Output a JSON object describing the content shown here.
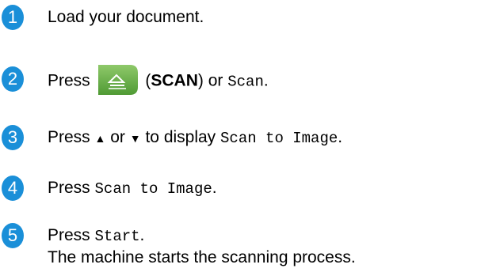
{
  "steps": [
    {
      "number": "1",
      "text": "Load your document."
    },
    {
      "number": "2",
      "press": "Press",
      "open_paren": "(",
      "scan_label": "SCAN",
      "close_or": ") or",
      "scan_mono": "Scan",
      "period": "."
    },
    {
      "number": "3",
      "press": "Press",
      "up": "▲",
      "or": "or",
      "down": "▼",
      "to_display": "to display",
      "mono": "Scan to Image",
      "period": "."
    },
    {
      "number": "4",
      "press": "Press",
      "mono": "Scan to Image",
      "period": "."
    },
    {
      "number": "5",
      "press": "Press",
      "mono": "Start",
      "period": ".",
      "line2": "The machine starts the scanning process."
    }
  ],
  "colors": {
    "step_badge": "#1a8fd8",
    "scan_button": "#6ab04c"
  },
  "icons": {
    "scan_button": "scan-document-icon"
  }
}
